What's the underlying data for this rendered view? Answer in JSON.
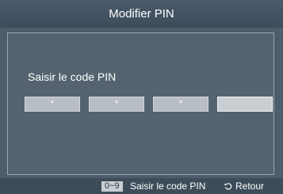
{
  "header": {
    "title": "Modifier PIN"
  },
  "dialog": {
    "prompt": "Saisir le code PIN",
    "pin_fields": [
      "*",
      "*",
      "*",
      ""
    ]
  },
  "footer": {
    "key_label": "0~9",
    "key_hint": "Saisir le code PIN",
    "return_icon": "return-arrow-icon",
    "return_label": "Retour"
  },
  "colors": {
    "background": "#4e5d6c",
    "footer": "#3e4c5a",
    "pin_field": "#b8bec4"
  }
}
